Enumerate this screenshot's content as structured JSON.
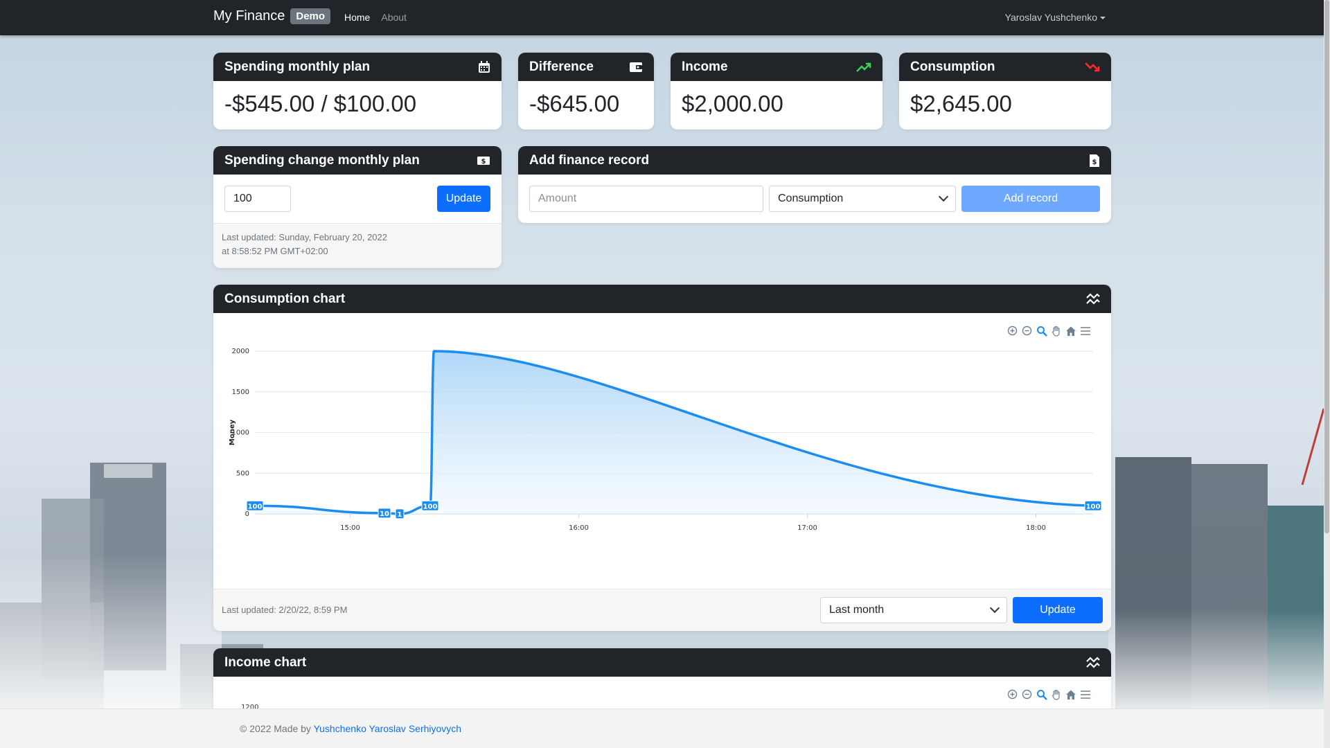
{
  "navbar": {
    "brand": "My Finance",
    "badge": "Demo",
    "links": [
      {
        "label": "Home",
        "active": true
      },
      {
        "label": "About",
        "active": false
      }
    ],
    "user": "Yaroslav Yushchenko"
  },
  "stats": {
    "spending_plan": {
      "title": "Spending monthly plan",
      "value": "-$545.00 / $100.00",
      "icon": "calendar-icon"
    },
    "difference": {
      "title": "Difference",
      "value": "-$645.00",
      "icon": "wallet-icon"
    },
    "income": {
      "title": "Income",
      "value": "$2,000.00",
      "icon": "trending-up-icon",
      "icon_color": "#39d353"
    },
    "consumption": {
      "title": "Consumption",
      "value": "$2,645.00",
      "icon": "trending-down-icon",
      "icon_color": "#ff2b2b"
    }
  },
  "plan_change": {
    "title": "Spending change monthly plan",
    "input_value": "100",
    "button_label": "Update",
    "last_updated_line1": "Last updated: Sunday, February 20, 2022",
    "last_updated_line2": "at 8:58:52 PM GMT+02:00"
  },
  "add_record": {
    "title": "Add finance record",
    "amount_placeholder": "Amount",
    "type_selected": "Consumption",
    "button_label": "Add record"
  },
  "consumption_chart": {
    "title": "Consumption chart",
    "last_updated": "Last updated: 2/20/22, 8:59 PM",
    "range_selected": "Last month",
    "button_label": "Update"
  },
  "income_chart": {
    "title": "Income chart",
    "first_tick": "1200"
  },
  "footer": {
    "text": "© 2022 Made by ",
    "author": "Yushchenko Yaroslav Serhiyovych"
  },
  "chart_data": {
    "type": "area",
    "title": "",
    "xlabel": "",
    "ylabel": "Money",
    "ylim": [
      0,
      2000
    ],
    "y_ticks": [
      "0",
      "500",
      "1000",
      "1500",
      "2000"
    ],
    "x_ticks": [
      "15:00",
      "16:00",
      "17:00",
      "18:00"
    ],
    "grid": true,
    "series": [
      {
        "points": [
          {
            "x": "14:35",
            "y": 100,
            "label": "100"
          },
          {
            "x": "15:09",
            "y": 10,
            "label": "10"
          },
          {
            "x": "15:13",
            "y": 1,
            "label": "1"
          },
          {
            "x": "15:21",
            "y": 100,
            "label": "100"
          },
          {
            "x": "15:22",
            "y": 2000,
            "label": ""
          },
          {
            "x": "18:15",
            "y": 100,
            "label": "100"
          }
        ]
      }
    ],
    "colors": {
      "line": "#1b8df0",
      "fill_top": "#a7d3f7",
      "fill_bottom": "#eef7fe"
    }
  }
}
